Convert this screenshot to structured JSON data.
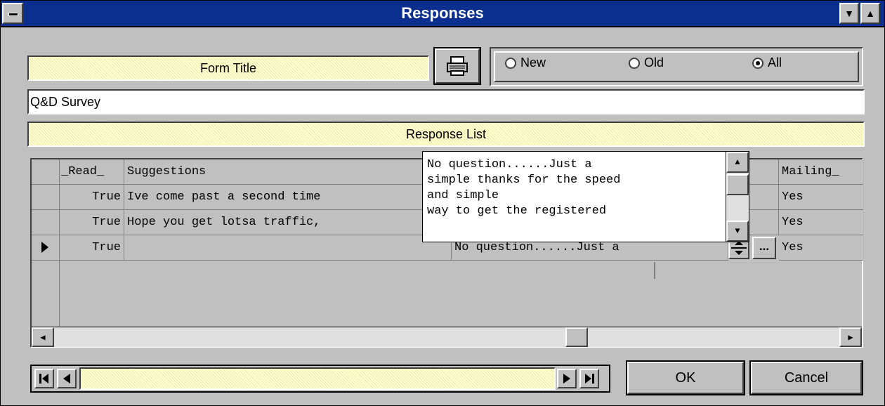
{
  "window": {
    "title": "Responses"
  },
  "header": {
    "form_title_label": "Form Title",
    "form_title_value": "Q&D Survey",
    "response_list_label": "Response List"
  },
  "filter": {
    "options": [
      {
        "label": "New",
        "selected": false
      },
      {
        "label": "Old",
        "selected": false
      },
      {
        "label": "All",
        "selected": true
      }
    ]
  },
  "grid": {
    "columns": {
      "read": "_Read_",
      "suggestions": "Suggestions",
      "mailing": "Mailing_"
    },
    "rows": [
      {
        "read": "True",
        "suggestions": "Ive come past a second time",
        "memo": "",
        "mailing": "Yes"
      },
      {
        "read": "True",
        "suggestions": "Hope you get lotsa traffic,",
        "memo": "",
        "mailing": "Yes"
      },
      {
        "read": "True",
        "suggestions": "",
        "memo": "No question......Just a",
        "mailing": "Yes"
      }
    ],
    "ellipsis": "...",
    "popup_lines": [
      "No question......Just a",
      "simple thanks for the speed",
      "and simple",
      "way to get the registered"
    ]
  },
  "buttons": {
    "ok": "OK",
    "cancel": "Cancel"
  },
  "colors": {
    "titlebar": "#0a2f8e",
    "highlight": "#ffffcc",
    "face": "#c0c0c0"
  },
  "icons": [
    "system-menu-icon",
    "minimize-icon",
    "maximize-icon",
    "print-icon",
    "first-record-icon",
    "prev-record-icon",
    "next-record-icon",
    "last-record-icon"
  ]
}
